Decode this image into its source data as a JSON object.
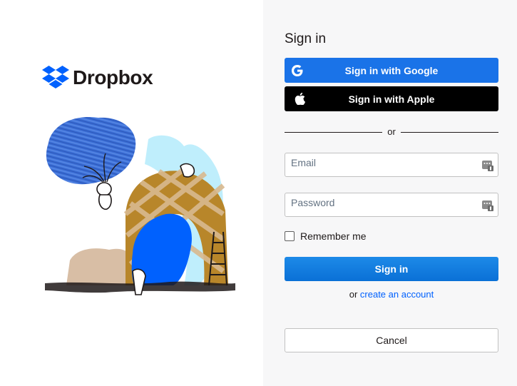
{
  "brand": {
    "name": "Dropbox",
    "color": "#0061fe"
  },
  "illustration": {
    "name": "dropbox-arch-illustration"
  },
  "form": {
    "title": "Sign in",
    "google_label": "Sign in with Google",
    "apple_label": "Sign in with Apple",
    "divider_text": "or",
    "email": {
      "label": "Email",
      "value": ""
    },
    "password": {
      "label": "Password",
      "value": ""
    },
    "remember_label": "Remember me",
    "remember_checked": false,
    "signin_label": "Sign in",
    "create_prefix": "or",
    "create_link": "create an account",
    "cancel_label": "Cancel"
  },
  "colors": {
    "google_button": "#1a73e8",
    "apple_button": "#000000",
    "primary_button": "#0a70d6",
    "link": "#0061fe",
    "right_pane_bg": "#f7f7f8"
  },
  "icons": [
    "dropbox-logo-icon",
    "google-icon",
    "apple-icon",
    "password-manager-icon"
  ]
}
